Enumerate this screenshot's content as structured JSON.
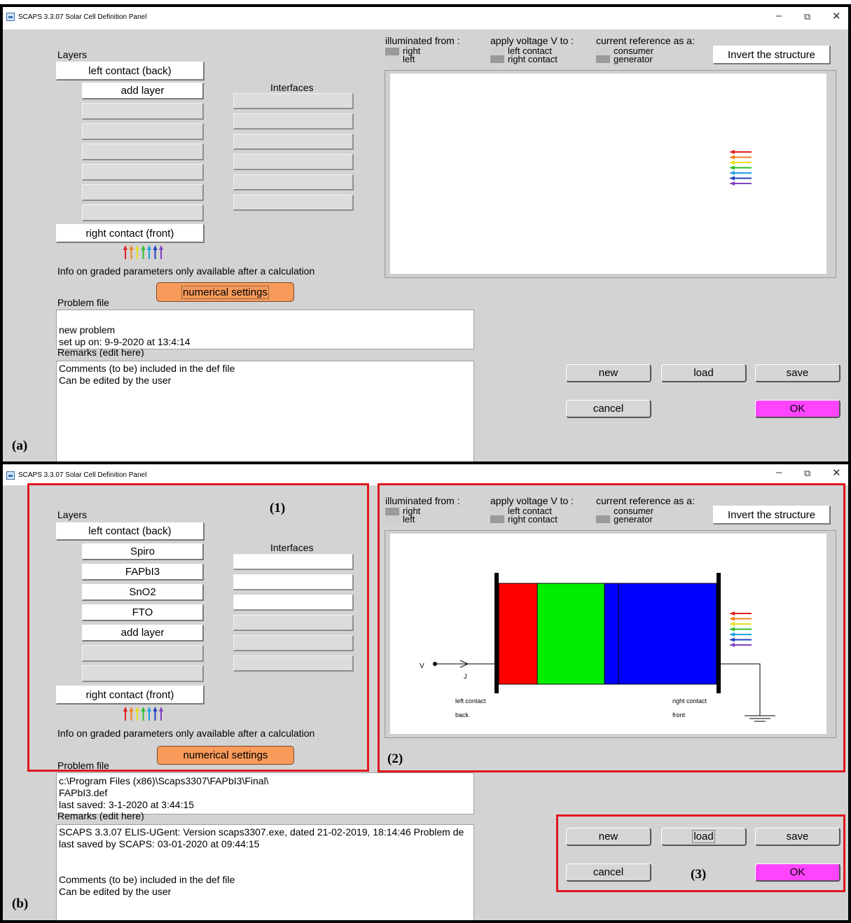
{
  "panel_a": {
    "window_title": "SCAPS 3.3.07 Solar Cell Definition Panel",
    "window_controls": {
      "minimize": "–",
      "restore": "⧉",
      "close": "✕"
    },
    "figure_label": "(a)",
    "layers_heading": "Layers",
    "left_contact": "left contact (back)",
    "layers": [
      "add layer"
    ],
    "right_contact": "right contact (front)",
    "interfaces_heading": "Interfaces",
    "info_text": "Info on graded parameters only available after a calculation",
    "numerical_settings": "numerical settings",
    "problem_file_label": "Problem file",
    "problem_file_lines": [
      "new problem",
      "set up on: 9-9-2020 at 13:4:14"
    ],
    "remarks_label": "Remarks (edit here)",
    "remarks_lines": [
      "Comments (to be) included in the def file",
      "Can be edited by the user"
    ],
    "illuminated_from": {
      "label": "illuminated from :",
      "options": [
        "right",
        "left"
      ]
    },
    "apply_voltage": {
      "label": "apply voltage V to :",
      "options": [
        "left contact",
        "right contact"
      ]
    },
    "current_reference": {
      "label": "current reference as a:",
      "options": [
        "consumer",
        "generator"
      ]
    },
    "invert_button": "Invert the structure",
    "buttons": {
      "new": "new",
      "load": "load",
      "save": "save",
      "cancel": "cancel",
      "ok": "OK"
    }
  },
  "panel_b": {
    "window_title": "SCAPS 3.3.07 Solar Cell Definition Panel",
    "window_controls": {
      "minimize": "–",
      "restore": "⧉",
      "close": "✕"
    },
    "figure_label": "(b)",
    "region_labels": [
      "(1)",
      "(2)",
      "(3)"
    ],
    "layers_heading": "Layers",
    "left_contact": "left contact (back)",
    "layers": [
      "Spiro",
      "FAPbI3",
      "SnO2",
      "FTO",
      "add layer"
    ],
    "right_contact": "right contact (front)",
    "interfaces_heading": "Interfaces",
    "info_text": "Info on graded parameters only available after a calculation",
    "numerical_settings": "numerical settings",
    "problem_file_label": "Problem file",
    "problem_file_lines": [
      "c:\\Program Files (x86)\\Scaps3307\\FAPbI3\\Final\\",
      "FAPbI3.def",
      "last saved: 3-1-2020 at 3:44:15"
    ],
    "remarks_label": "Remarks (edit here)",
    "remarks_lines": [
      "SCAPS 3.3.07 ELIS-UGent: Version scaps3307.exe, dated 21-02-2019, 18:14:46 Problem de",
      "last saved by SCAPS: 03-01-2020 at 09:44:15",
      "",
      "",
      "Comments (to be) included in the def file",
      "Can be edited by the user"
    ],
    "illuminated_from": {
      "label": "illuminated from :",
      "options": [
        "right",
        "left"
      ]
    },
    "apply_voltage": {
      "label": "apply voltage V to :",
      "options": [
        "left contact",
        "right contact"
      ]
    },
    "current_reference": {
      "label": "current reference as a:",
      "options": [
        "consumer",
        "generator"
      ]
    },
    "invert_button": "Invert the structure",
    "buttons": {
      "new": "new",
      "load": "load",
      "save": "save",
      "cancel": "cancel",
      "ok": "OK"
    },
    "diagram": {
      "v_label": "V",
      "j_label": "J",
      "left_contact_label": "left contact",
      "left_side_label": "back",
      "right_contact_label": "right contact",
      "right_side_label": "front",
      "layer_colors": [
        "#ff0000",
        "#00ee00",
        "#0000ff",
        "#0000ff"
      ]
    }
  },
  "colors": {
    "panel_bg": "#d3d3d3",
    "ok_button": "#ff44ff",
    "numerical_settings": "#f79a5a",
    "highlight_box": "#e0161e"
  },
  "arrow_colors": [
    "#e02020",
    "#f08020",
    "#e8e020",
    "#30c030",
    "#20a0e0",
    "#2040c0",
    "#8040c0"
  ]
}
